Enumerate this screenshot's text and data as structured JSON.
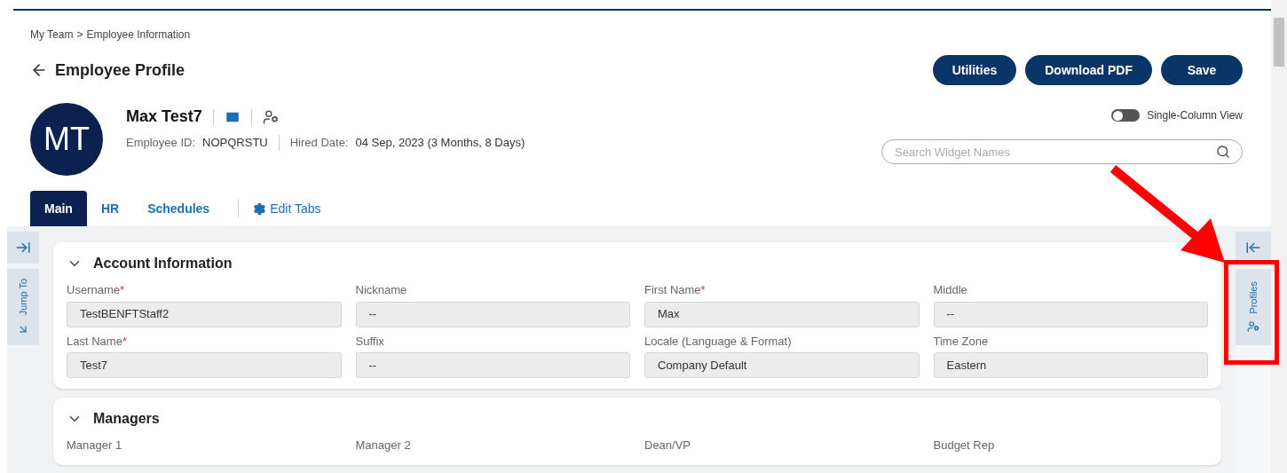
{
  "breadcrumb": {
    "items": [
      "My Team",
      "Employee Information"
    ],
    "separator": ">"
  },
  "page_title": "Employee Profile",
  "actions": [
    "Utilities",
    "Download PDF",
    "Save"
  ],
  "employee": {
    "initials": "MT",
    "name": "Max Test7",
    "id_label": "Employee ID:",
    "id_value": "NOPQRSTU",
    "hired_label": "Hired Date:",
    "hired_value": "04 Sep, 2023 (3 Months, 8 Days)"
  },
  "single_column_view": {
    "label": "Single-Column View",
    "on": false
  },
  "search": {
    "placeholder": "Search Widget Names"
  },
  "tabs": [
    {
      "label": "Main",
      "selected": true
    },
    {
      "label": "HR",
      "selected": false
    },
    {
      "label": "Schedules",
      "selected": false
    }
  ],
  "edit_tabs": "Edit Tabs",
  "left_rail": {
    "label": "Jump To"
  },
  "right_rail": {
    "label": "Profiles"
  },
  "required_mark": "*",
  "sections": [
    {
      "title": "Account Information",
      "expanded": true,
      "fields": [
        {
          "label": "Username",
          "required": true,
          "value": "TestBENFTStaff2"
        },
        {
          "label": "Nickname",
          "required": false,
          "value": "--"
        },
        {
          "label": "First Name",
          "required": true,
          "value": "Max"
        },
        {
          "label": "Middle",
          "required": false,
          "value": "--"
        },
        {
          "label": "Last Name",
          "required": true,
          "value": "Test7"
        },
        {
          "label": "Suffix",
          "required": false,
          "value": "--"
        },
        {
          "label": "Locale (Language & Format)",
          "required": false,
          "value": "Company Default"
        },
        {
          "label": "Time Zone",
          "required": false,
          "value": "Eastern"
        }
      ]
    },
    {
      "title": "Managers",
      "expanded": true,
      "fields": [
        {
          "label": "Manager 1",
          "required": false
        },
        {
          "label": "Manager 2",
          "required": false
        },
        {
          "label": "Dean/VP",
          "required": false
        },
        {
          "label": "Budget Rep",
          "required": false
        }
      ]
    }
  ]
}
